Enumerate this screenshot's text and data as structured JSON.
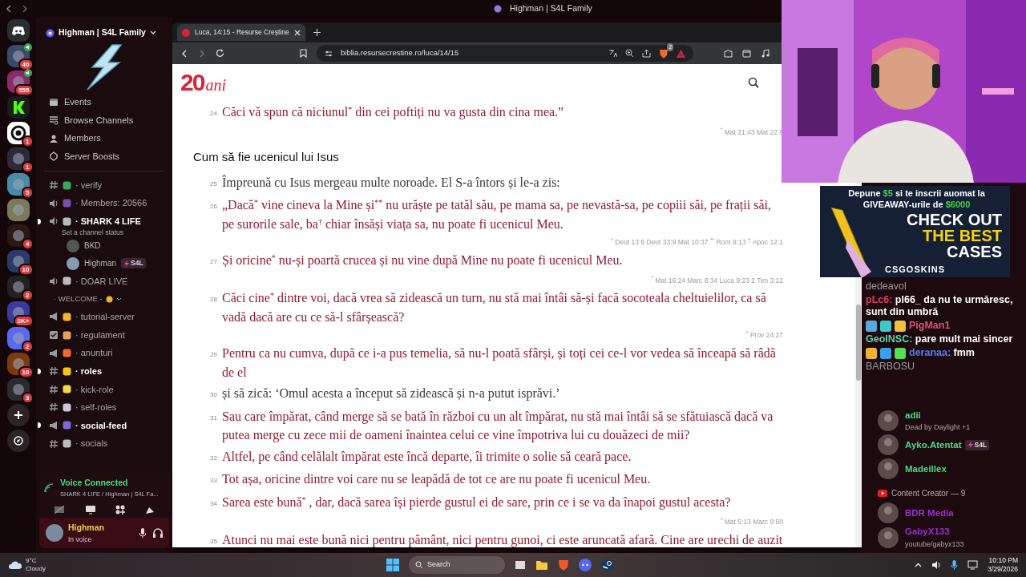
{
  "titlebar": {
    "title": "Highman | S4L Family"
  },
  "servers": [
    {
      "badge": "40",
      "voice": true
    },
    {
      "badge": "555",
      "voice": true
    },
    {
      "voice": false
    },
    {
      "badge": "1",
      "voice": false
    },
    {
      "badge": "1",
      "voice": false
    },
    {
      "badge": "5",
      "voice": false
    },
    {
      "voice": false
    },
    {
      "badge": "4",
      "voice": false
    },
    {
      "badge": "10",
      "voice": false
    },
    {
      "badge": "2",
      "voice": false
    },
    {
      "badge": "2K+",
      "voice": false
    },
    {
      "badge": "2",
      "voice": false
    },
    {
      "badge": "10",
      "voice": false
    },
    {
      "badge": "3",
      "voice": false
    }
  ],
  "server": {
    "name": "Highman | S4L Family",
    "menu": [
      {
        "kind": "events",
        "label": "Events"
      },
      {
        "kind": "browse",
        "label": "Browse Channels"
      },
      {
        "kind": "members",
        "label": "Members"
      },
      {
        "kind": "boosts",
        "label": "Server Boosts"
      }
    ],
    "channels": [
      {
        "kind": "text",
        "name": "· verify",
        "unread": false,
        "color": "#3ba55c"
      },
      {
        "kind": "voice",
        "name": "· Members: 20566",
        "unread": false,
        "color": "#7b4fb0"
      },
      {
        "kind": "voice",
        "name": "· SHARK 4 LIFE",
        "unread": true,
        "color": "#b9bbbe",
        "status": "Set a channel status",
        "users": [
          {
            "name": "BKD"
          },
          {
            "name": "Highman",
            "tag": "S4L"
          }
        ]
      },
      {
        "kind": "voice",
        "name": "· DOAR LIVE",
        "unread": false,
        "color": "#b9bbbe"
      },
      {
        "kind": "category",
        "name": "· WELCOME -"
      },
      {
        "kind": "announce",
        "name": "· tutorial-server",
        "unread": false,
        "color": "#f2b233"
      },
      {
        "kind": "rules",
        "name": "· regulament",
        "unread": false,
        "color": "#e0a060"
      },
      {
        "kind": "announce",
        "name": "· anunturi",
        "unread": false,
        "color": "#f06a30"
      },
      {
        "kind": "text",
        "name": "· roles",
        "unread": true,
        "color": "#f5c518"
      },
      {
        "kind": "text",
        "name": "· kick-role",
        "unread": false,
        "color": "#f5d848"
      },
      {
        "kind": "text",
        "name": "· self-roles",
        "unread": false,
        "color": "#c8c8d8"
      },
      {
        "kind": "announce",
        "name": "· social-feed",
        "unread": true,
        "color": "#7a6ad8"
      },
      {
        "kind": "text",
        "name": "· socials",
        "unread": false,
        "color": "#b9bbbe"
      }
    ]
  },
  "voice_panel": {
    "title": "Voice Connected",
    "channel": "SHARK 4 LIFE / Highman | S4L Fa..."
  },
  "user_panel": {
    "name": "Highman",
    "status": "In voice"
  },
  "browser": {
    "tab": {
      "title": "Luca, 14:15 - Resurse Creștine"
    },
    "url": "biblia.resursecrestine.ro/luca/14/15",
    "shield_count": "2",
    "logo": {
      "number": "20",
      "word": "ani"
    },
    "items": [
      {
        "kind": "verse",
        "number": "24",
        "jesus": true,
        "text": "Căci vă spun că niciunul$^{*}$ din cei poftiți nu va gusta din cina mea.”",
        "refs": "$^{*}$ Mat 21:43 Mat 22:8"
      },
      {
        "kind": "heading",
        "text": "Cum să fie ucenicul lui Isus"
      },
      {
        "kind": "verse",
        "number": "25",
        "jesus": false,
        "text": "Împreună cu Isus mergeau multe noroade. El S-a întors și le-a zis:"
      },
      {
        "kind": "verse",
        "number": "26",
        "jesus": true,
        "text": "„Dacă$^{*}$ vine cineva la Mine și$^{**}$ nu urăște pe tatăl său, pe mama sa, pe nevastă-sa, pe copiii săi, pe frații săi, pe surorile sale, ba$^{†}$ chiar însăși viața sa, nu poate fi ucenicul Meu.",
        "refs": "$^{*}$ Deut 13:6 Deut 33:9 Mat 10:37 $^{**}$ Rom 9:13 $^{†}$ Apoc 12:1"
      },
      {
        "kind": "verse",
        "number": "27",
        "jesus": true,
        "text": "Și oricine$^{*}$ nu-și poartă crucea și nu vine după Mine nu poate fi ucenicul Meu.",
        "refs": "$^{*}$ Mat 16:24 Marc 8:34 Luca 9:23 2 Tim 3:12"
      },
      {
        "kind": "verse",
        "number": "28",
        "jesus": true,
        "text": "Căci cine$^{*}$ dintre voi, dacă vrea să zidească un turn, nu stă mai întâi să-și facă socoteala cheltuielilor, ca să vadă dacă are cu ce să-l sfârșească?",
        "refs": "$^{*}$ Prov 24:27"
      },
      {
        "kind": "verse",
        "number": "29",
        "jesus": true,
        "text": "Pentru ca nu cumva, după ce i-a pus temelia, să nu-l poată sfârși, și toți cei ce-l vor vedea să înceapă să râdă de el"
      },
      {
        "kind": "verse",
        "number": "30",
        "jesus": false,
        "text": "și să zică: ‘Omul acesta a început să zidească și n-a putut isprăvi.’"
      },
      {
        "kind": "verse",
        "number": "31",
        "jesus": true,
        "text": "Sau care împărat, când merge să se bată în război cu un alt împărat, nu stă mai întâi să se sfătuiască dacă va putea merge cu zece mii de oameni înaintea celui ce vine împotriva lui cu douăzeci de mii?"
      },
      {
        "kind": "verse",
        "number": "32",
        "jesus": true,
        "text": "Altfel, pe când celălalt împărat este încă departe, îi trimite o solie să ceară pace."
      },
      {
        "kind": "verse",
        "number": "33",
        "jesus": true,
        "text": "Tot așa, oricine dintre voi care nu se leapădă de tot ce are nu poate fi ucenicul Meu."
      },
      {
        "kind": "verse",
        "number": "34",
        "jesus": true,
        "text": "Sarea este bună$^{*}$ , dar, dacă sarea își pierde gustul ei de sare, prin ce i se va da înapoi gustul acesta?",
        "refs": "$^{*}$ Mat 5:13 Marc 9:50"
      },
      {
        "kind": "verse",
        "number": "35",
        "jesus": true,
        "text": "Atunci nu mai este bună nici pentru pământ, nici pentru gunoi, ci este aruncată afară. Cine are urechi de auzit"
      }
    ]
  },
  "ad": {
    "lines": [
      [
        {
          "text": "Depune ",
          "accent": false
        },
        {
          "text": "$5",
          "accent": true
        },
        {
          "text": " si te inscrii auomat la",
          "accent": false
        }
      ],
      [
        {
          "text": "GIVEAWAY-urile de ",
          "accent": false
        },
        {
          "text": "$6000",
          "accent": true
        }
      ]
    ],
    "headline": [
      {
        "text": "CHECK OUT",
        "accent": false
      },
      {
        "text": "THE BEST",
        "accent": true
      },
      {
        "text": "CASES",
        "accent": false
      }
    ],
    "brand": "CSGOSKINS"
  },
  "chat": [
    {
      "kind": "faded",
      "user": "dedeavol",
      "color": "#9a9a9a"
    },
    {
      "kind": "message",
      "user": "pLc6:",
      "color": "#e0405a",
      "text": "pl66_ da nu te urmăresc, sunt din umbră"
    },
    {
      "kind": "message",
      "user": "PigMan1",
      "color": "#e0507a",
      "badges": [
        {
          "color": "#5aa7e0"
        },
        {
          "color": "#40c8c8"
        },
        {
          "color": "#f0c040"
        }
      ]
    },
    {
      "kind": "message",
      "user": "GeoINSC:",
      "color": "#5fd3a8",
      "text": "pare mult mai sincer"
    },
    {
      "kind": "message",
      "user": "deranaa:",
      "color": "#5a7af0",
      "text": "fmm",
      "badges": [
        {
          "color": "#f0b030"
        },
        {
          "color": "#3aa0e8"
        },
        {
          "color": "#50e050"
        }
      ]
    },
    {
      "kind": "faded",
      "user": "BARBOSU",
      "color": "#9a9a9a"
    }
  ],
  "members": [
    {
      "kind": "member",
      "name": "adii",
      "color": "#4ade80",
      "activity": "Dead by Daylight +1"
    },
    {
      "kind": "member",
      "name": "Ayko.Atentat",
      "color": "#4ade80",
      "tag": "S4L"
    },
    {
      "kind": "member",
      "name": "Madeillex",
      "color": "#4ade80"
    },
    {
      "kind": "section",
      "label": "Content Creator — 9"
    },
    {
      "kind": "member",
      "name": "BDR Media",
      "color": "#9b30d0"
    },
    {
      "kind": "member",
      "name": "GabyX133",
      "color": "#9b30d0",
      "activity": "youtube/gabyx133"
    }
  ],
  "taskbar": {
    "temperature": "9°C",
    "weather": "Cloudy",
    "search": "Search",
    "time": "10:10 PM",
    "date": "3/29/2026"
  }
}
